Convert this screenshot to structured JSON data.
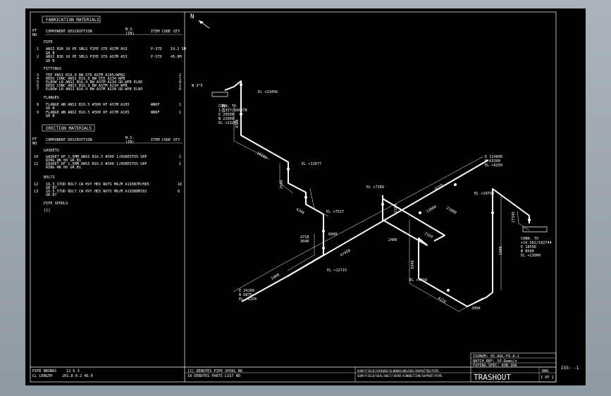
{
  "north": "N",
  "fab": {
    "title": "FABRICATION MATERIALS",
    "pt_no": [
      "PT",
      "NO"
    ],
    "col_desc": "COMPONENT DESCRIPTION",
    "col_ns": [
      "N.S.",
      "(IN)"
    ],
    "col_code": "ITEM CODE",
    "col_qty": "QTY",
    "sections": {
      "pipe": "PIPE",
      "fittings": "FITTINGS",
      "flanges": "FLANGES"
    },
    "pipe": [
      {
        "no": "1",
        "line1": "ANSI B36 10 PE SMLS PIPE STD ASTM A53",
        "line2": "GR B",
        "code": "P-STD",
        "qty": "19.2 SM"
      },
      {
        "no": "2",
        "line1": "ANSI B36 10 PE SMLS PIPE STD ASTM A53",
        "line2": "GR B",
        "code": "P-STD",
        "qty": "45.0M"
      }
    ],
    "fittings": [
      {
        "no": "3",
        "text": "TEE ANSI B16.9 BW STD ASTM A105/WPB2",
        "qty": "2"
      },
      {
        "no": "4",
        "text": "REDU CONC ANSI B16.9 BW STD A234 WPB",
        "qty": "1"
      },
      {
        "no": "5",
        "text": "ELBOW LR ANSI B16.9 BW ASTM A234 GR.WPB ELBO",
        "qty": "8"
      },
      {
        "no": "6",
        "text": "REDU CONC ANSI B16.9 BW ASTM A234 WPB",
        "qty": "1"
      },
      {
        "no": "7",
        "text": "ELBOW LR ANSI B16.9 BW ASTM A234 GR.WPB ELBO",
        "qty": "6"
      }
    ],
    "flanges": [
      {
        "no": "8",
        "line1": "FLANGE WN ANSI B16.5 #300 RF ASTM A105",
        "line2": "GR B",
        "code": "WNRF",
        "qty": "1"
      },
      {
        "no": "9",
        "line1": "FLANGE WN ANSI B16.5 #300 RF ASTM A105",
        "line2": "GR B",
        "code": "WNRF",
        "qty": "1"
      }
    ]
  },
  "erection": {
    "title": "ERECTION MATERIALS",
    "gaskets_title": "GASKETS",
    "gaskets": [
      {
        "no": "10",
        "line1": "GASKET RF 1.5MM ANSI B16.5 #300 1/8SBESTOS GRF",
        "line2": "RING WR 00 GR B1",
        "qty": "1"
      },
      {
        "no": "11",
        "line1": "GASKET RF 1.5MM ANSI B16.5 #300 1/8SBESTOS GRF",
        "line2": "RING WR 00 GR B1",
        "qty": "1"
      }
    ],
    "bolts_title": "BOLTS",
    "bolts": [
      {
        "no": "12",
        "line1": "16.5 STUD BOLT CW HVY HEX NUTS M6/M A193B7M/H65",
        "line2": "GR B7",
        "qty": "16"
      },
      {
        "no": "13",
        "line1": "16.5 STUD BOLT CW HVY HEX NUTS M6/M A193B8M102",
        "line2": "GR B7",
        "qty": "8"
      }
    ],
    "spools_title": "PIPE SPOOLS",
    "spools": "[1]"
  },
  "iso_labels": {
    "el_23456": "EL +23456",
    "el_11677": "EL +11677",
    "el_7527": "EL +7527",
    "el_7189": "EL +7189",
    "el_29793": "EL +29793",
    "el_5034": "EL +5034",
    "el_12715": "EL +12715",
    "el_6250": "EL +6250",
    "ww_left": "W 3°5",
    "conn_l": [
      "CONN. TO",
      "1·1357/166378",
      "E 29500",
      "N 22000",
      "EL +23261"
    ],
    "conn_r": [
      "CONN. TO",
      "+19.562/182744",
      "E 18500",
      "N 8500",
      "EL +23000"
    ],
    "coord_tr": [
      "E 114800",
      "N 63300",
      "EL +6250"
    ],
    "coord_bl": [
      "E 24100",
      "N 6875",
      "EL +6250"
    ],
    "dims": [
      "7778",
      "4779",
      "10100",
      "2549",
      "6346",
      "4718",
      "3040",
      "6000",
      "2406",
      "47450",
      "5408",
      "12000",
      "2164",
      "9349",
      "4216",
      "2000",
      "1999",
      "21800",
      "4719",
      "27345",
      "2169"
    ]
  },
  "footer": {
    "pipe_label": "PIPE NBSN01",
    "pipe_vals": "12    6    3",
    "length_label": "CL LENGTH",
    "length_vals": "201.8  0.2  46.4",
    "notes": [
      "[1] DENOTES PIPE SPOOL NO",
      "10 DENOTES PARTS LIST NO"
    ],
    "legend": [
      "SHOP/FIELD/SCREWED/ELBOWED/WELDED/INSPECTED/PIPE",
      "SHOP/FIELD/SEAL/BOLT/JOINT/CONNECTION/SUPPORT/PIPE"
    ],
    "isonum": "ISONUM: 01-AUL-FA-A-1",
    "batch": "BATCH REF: SP-Demo/x",
    "piping_spec": "PIPING SPEC: A3B-1RA",
    "title": "TRASHOUT",
    "dwg": "DWG",
    "sheet": "1 OF 1",
    "iss": "ISS: -1"
  }
}
